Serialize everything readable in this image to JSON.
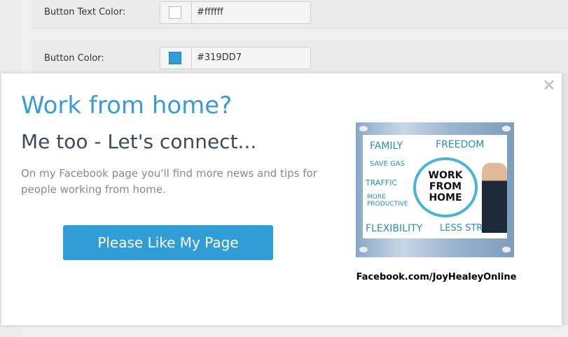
{
  "settings": {
    "rows": [
      {
        "label": "Button Text Color:",
        "value": "#ffffff",
        "swatch": "#ffffff"
      },
      {
        "label": "Button Color:",
        "value": "#319DD7",
        "swatch": "#319dd7"
      }
    ]
  },
  "popup": {
    "close_icon": "×",
    "headline": "Work from home?",
    "subheadline": "Me too - Let's connect...",
    "description": "On my Facebook page you'll find more news and tips for people working from home.",
    "button_label": "Please Like My Page",
    "facebook_url": "Facebook.com/JoyHealeyOnline",
    "image": {
      "center_text": "WORK FROM HOME",
      "words": [
        "FAMILY",
        "FREEDOM",
        "SAVE GAS",
        "TRAFFIC",
        "MORE PRODUCTIVE",
        "FLEXIBILITY",
        "LESS STRESS"
      ]
    }
  },
  "colors": {
    "accent": "#3a9bd9",
    "button": "#319dd7",
    "subheadline": "#3c4a5c",
    "description": "#8a8a8a"
  }
}
